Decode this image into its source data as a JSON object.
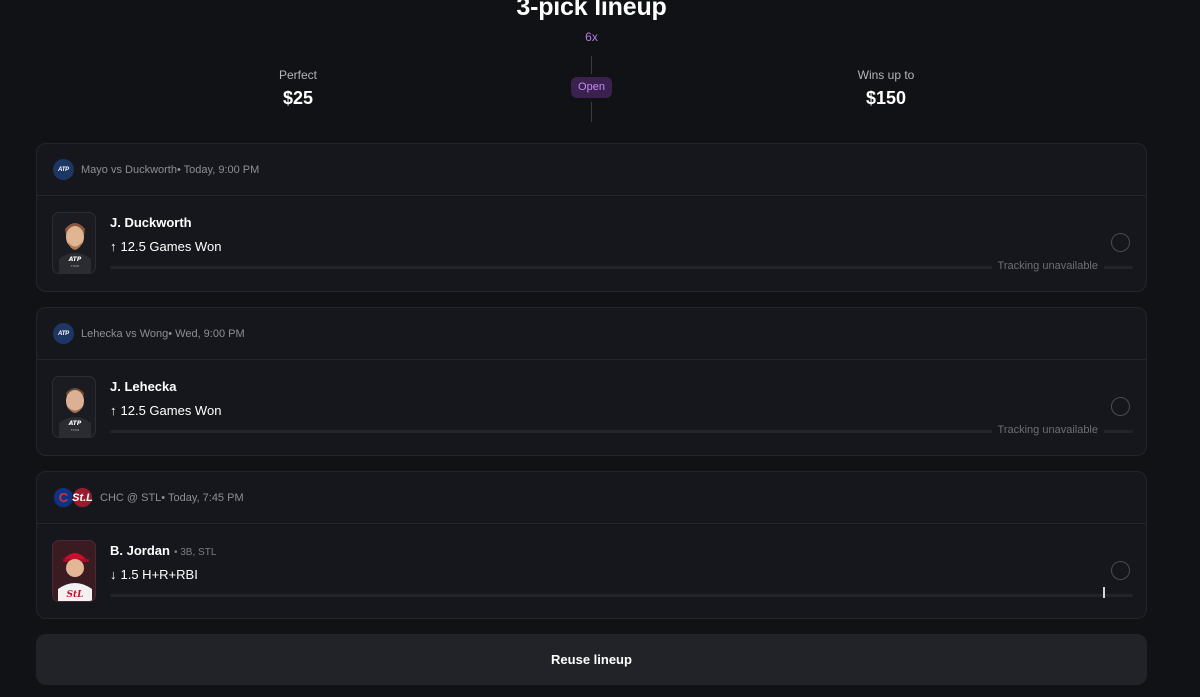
{
  "header": {
    "title": "3-pick lineup",
    "multiplier": "6x",
    "status_badge": "Open",
    "perfect_label": "Perfect",
    "perfect_value": "$25",
    "wins_label": "Wins up to",
    "wins_value": "$150"
  },
  "picks": [
    {
      "league_logo": "ATP",
      "match": "Mayo vs Duckworth• Today, 9:00 PM",
      "player": "J. Duckworth",
      "meta": "",
      "direction": "↑",
      "line": "12.5 Games Won",
      "tracking": "Tracking unavailable"
    },
    {
      "league_logo": "ATP",
      "match": "Lehecka vs Wong• Wed, 9:00 PM",
      "player": "J. Lehecka",
      "meta": "",
      "direction": "↑",
      "line": "12.5 Games Won",
      "tracking": "Tracking unavailable"
    },
    {
      "team_logos": [
        "C",
        "St.L"
      ],
      "match": "CHC @ STL• Today, 7:45 PM",
      "player": "B. Jordan",
      "meta": "• 3B, STL",
      "direction": "↓",
      "line": "1.5 H+R+RBI",
      "tracking": ""
    }
  ],
  "footer": {
    "reuse_label": "Reuse lineup"
  }
}
